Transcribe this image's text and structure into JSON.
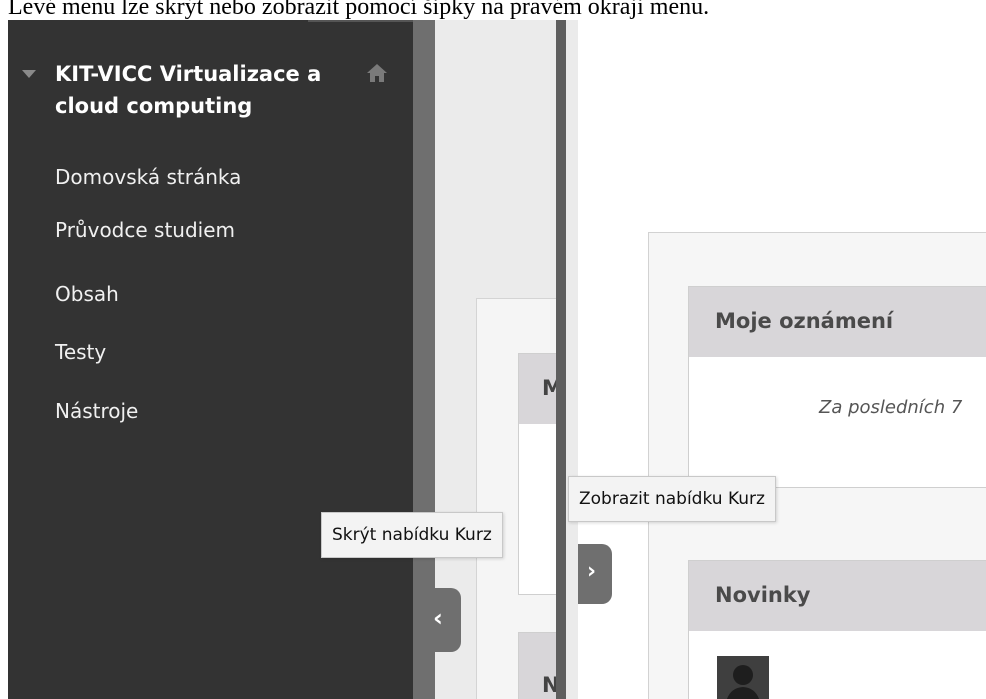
{
  "caption": "Levé menu lze skrýt nebo zobrazit pomocí šipky na pravém okraji menu.",
  "left_panel": {
    "course_title": "KIT-VICC Virtualizace a cloud computing",
    "nav_items": [
      {
        "label": "Domovská stránka"
      },
      {
        "label": "Průvodce studiem"
      },
      {
        "label": "Obsah"
      },
      {
        "label": "Testy"
      },
      {
        "label": "Nástroje"
      }
    ],
    "hide_tooltip": "Skrýt nabídku Kurz",
    "hide_toggle_glyph": "‹",
    "partial_module_letter_1": "M",
    "partial_module_letter_2": "N",
    "icons": {
      "home": "home-icon",
      "caret": "caret-down-icon",
      "toggle": "chevron-left-icon"
    }
  },
  "right_panel": {
    "show_tooltip": "Zobrazit nabídku Kurz",
    "show_toggle_glyph": "›",
    "modules": [
      {
        "title": "Moje oznámení",
        "body_text": "Za posledních 7"
      },
      {
        "title": "Novinky"
      }
    ],
    "icons": {
      "toggle": "chevron-right-icon",
      "avatar": "user-avatar-icon"
    }
  },
  "colors": {
    "sidebar_bg": "#333333",
    "module_header": "#d8d6d9",
    "toggle": "#6f6f6f"
  }
}
